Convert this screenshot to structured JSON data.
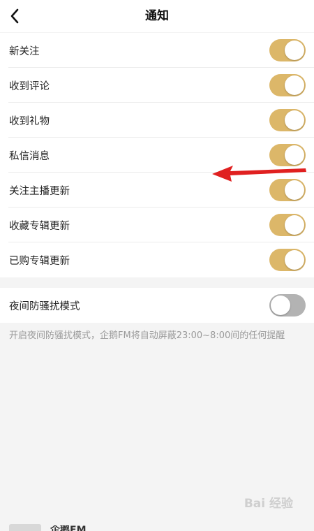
{
  "header": {
    "title": "通知"
  },
  "settings": [
    {
      "label": "新关注",
      "on": true
    },
    {
      "label": "收到评论",
      "on": true
    },
    {
      "label": "收到礼物",
      "on": true
    },
    {
      "label": "私信消息",
      "on": true
    },
    {
      "label": "关注主播更新",
      "on": true
    },
    {
      "label": "收藏专辑更新",
      "on": true
    },
    {
      "label": "已购专辑更新",
      "on": true
    }
  ],
  "night_mode": {
    "label": "夜间防骚扰模式",
    "on": false,
    "hint": "开启夜间防骚扰模式，企鹅FM将自动屏蔽23:00~8:00间的任何提醒"
  },
  "bottom": {
    "partial_text": "企鹅FM"
  },
  "watermark": {
    "text": "Bai 经验"
  },
  "colors": {
    "toggle_on": "#dcb769",
    "toggle_off": "#b3b3b3",
    "annotation_arrow": "#e02020"
  }
}
